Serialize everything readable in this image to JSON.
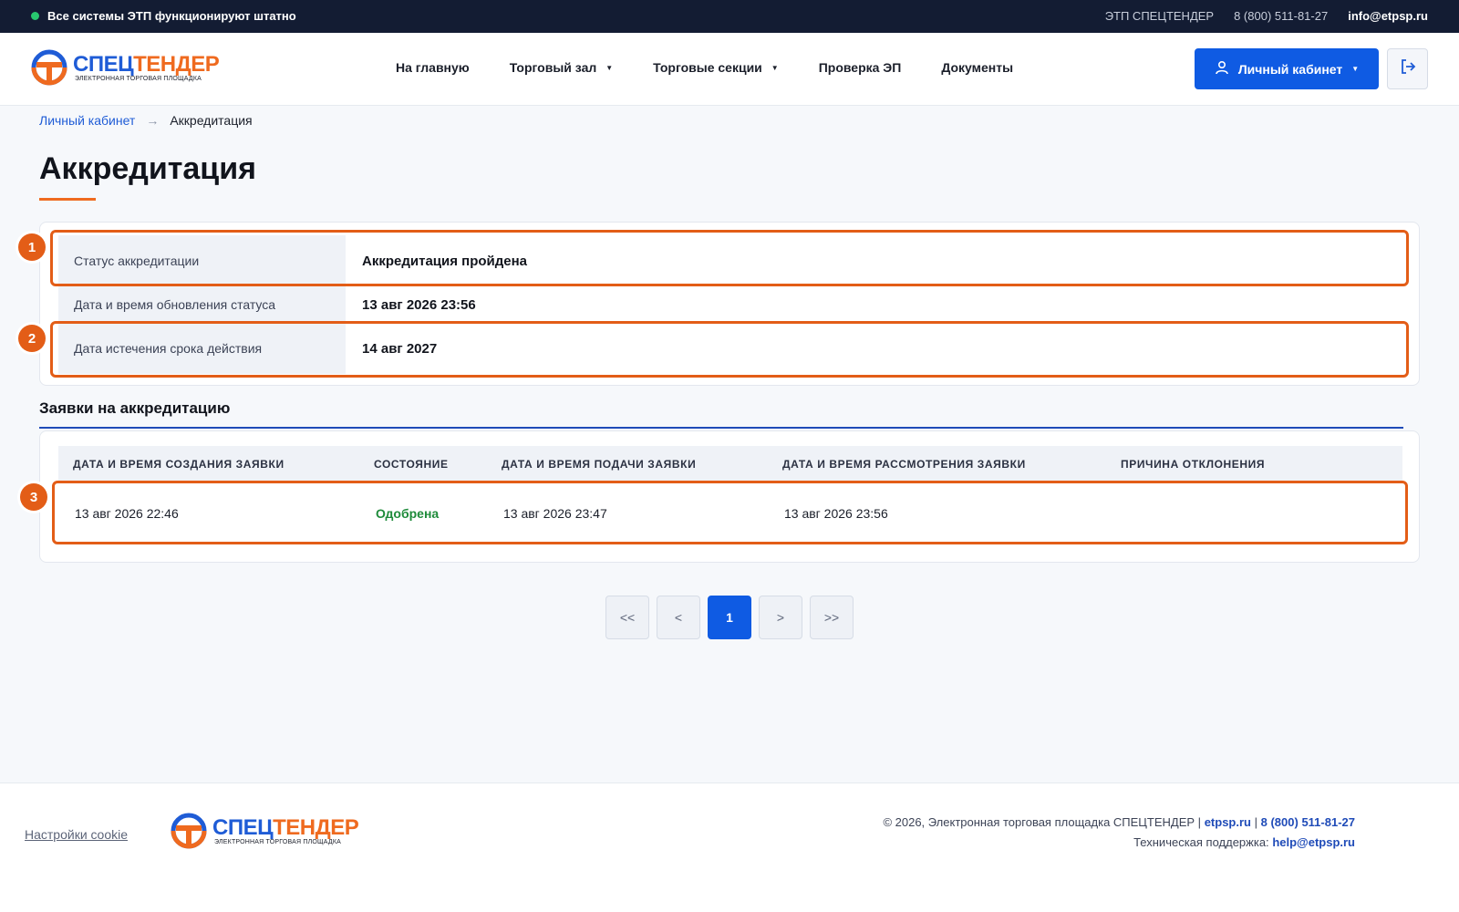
{
  "topbar": {
    "status": "Все системы ЭТП функционируют штатно",
    "platform": "ЭТП СПЕЦТЕНДЕР",
    "phone": "8 (800) 511-81-27",
    "email": "info@etpsp.ru"
  },
  "logo": {
    "part1": "СПЕЦ",
    "part2": "ТЕНДЕР",
    "subtitle": "ЭЛЕКТРОННАЯ ТОРГОВАЯ ПЛОЩАДКА"
  },
  "nav": {
    "home": "На главную",
    "trading_hall": "Торговый зал",
    "sections": "Торговые секции",
    "check_ep": "Проверка ЭП",
    "documents": "Документы"
  },
  "header": {
    "cabinet_label": "Личный кабинет"
  },
  "breadcrumb": {
    "parent": "Личный кабинет",
    "separator": "→",
    "current": "Аккредитация"
  },
  "page": {
    "title": "Аккредитация"
  },
  "accreditation": {
    "rows": [
      {
        "label": "Статус аккредитации",
        "value": "Аккредитация пройдена"
      },
      {
        "label": "Дата и время обновления статуса",
        "value": "13 авг 2026 23:56"
      },
      {
        "label": "Дата истечения срока действия",
        "value": "14 авг 2027"
      }
    ]
  },
  "applications": {
    "title": "Заявки на аккредитацию",
    "columns": [
      "ДАТА И ВРЕМЯ СОЗДАНИЯ ЗАЯВКИ",
      "СОСТОЯНИЕ",
      "ДАТА И ВРЕМЯ ПОДАЧИ ЗАЯВКИ",
      "ДАТА И ВРЕМЯ РАССМОТРЕНИЯ ЗАЯВКИ",
      "ПРИЧИНА ОТКЛОНЕНИЯ"
    ],
    "rows": [
      {
        "created": "13 авг 2026 22:46",
        "state": "Одобрена",
        "submitted": "13 авг 2026 23:47",
        "reviewed": "13 авг 2026 23:56",
        "reason": ""
      }
    ]
  },
  "pagination": {
    "first": "<<",
    "prev": "<",
    "current": "1",
    "next": ">",
    "last": ">>"
  },
  "annotations": [
    "1",
    "2",
    "3"
  ],
  "footer": {
    "cookie": "Настройки cookie",
    "copyright": "© 2026, Электронная торговая площадка СПЕЦТЕНДЕР |",
    "site": "etpsp.ru",
    "divider": "|",
    "phone": "8 (800) 511-81-27",
    "support_label": "Техническая поддержка:",
    "support_email": "help@etpsp.ru"
  },
  "colors": {
    "brand_blue": "#1f5cd6",
    "brand_orange": "#ef6a1f",
    "primary_button": "#0f5be3",
    "highlight": "#e35d17",
    "approved": "#1e8b3a"
  }
}
